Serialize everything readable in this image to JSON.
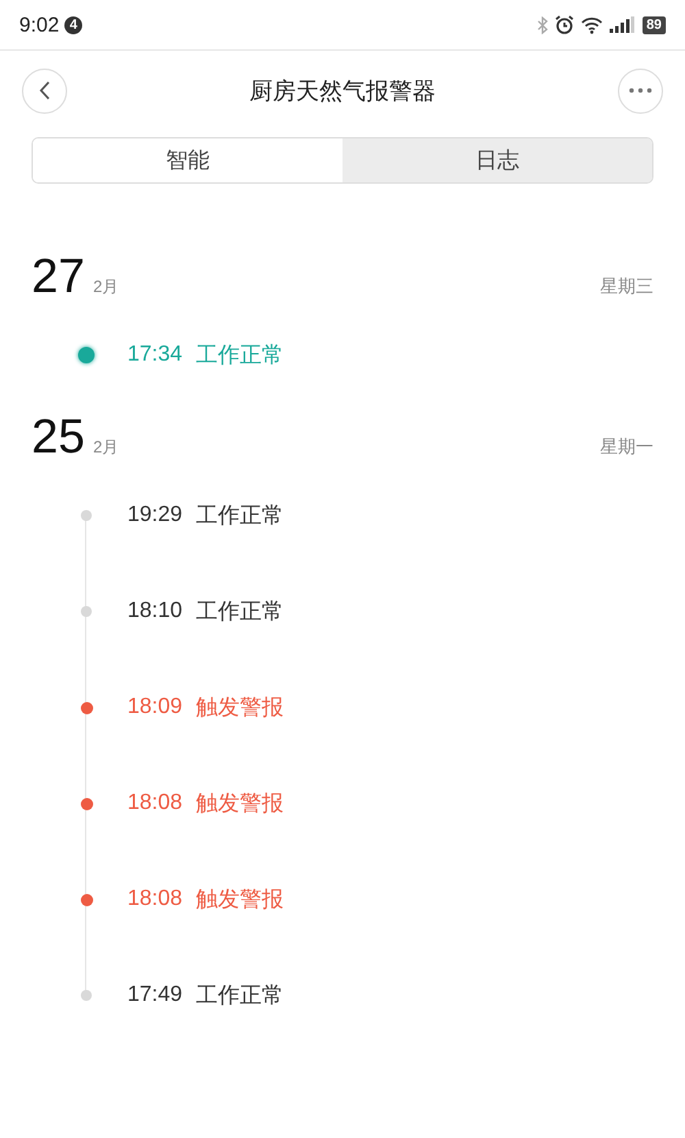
{
  "status_bar": {
    "time": "9:02",
    "notification_count": "4",
    "battery": "89"
  },
  "header": {
    "title": "厨房天然气报警器"
  },
  "tabs": [
    {
      "label": "智能",
      "selected": false
    },
    {
      "label": "日志",
      "selected": true
    }
  ],
  "days": [
    {
      "day": "27",
      "month": "2月",
      "weekday": "星期三",
      "entries": [
        {
          "kind": "latest",
          "time": "17:34",
          "event": "工作正常"
        }
      ]
    },
    {
      "day": "25",
      "month": "2月",
      "weekday": "星期一",
      "entries": [
        {
          "kind": "normal",
          "time": "19:29",
          "event": "工作正常"
        },
        {
          "kind": "normal",
          "time": "18:10",
          "event": "工作正常"
        },
        {
          "kind": "alarm",
          "time": "18:09",
          "event": "触发警报"
        },
        {
          "kind": "alarm",
          "time": "18:08",
          "event": "触发警报"
        },
        {
          "kind": "alarm",
          "time": "18:08",
          "event": "触发警报"
        },
        {
          "kind": "normal",
          "time": "17:49",
          "event": "工作正常"
        }
      ]
    }
  ]
}
